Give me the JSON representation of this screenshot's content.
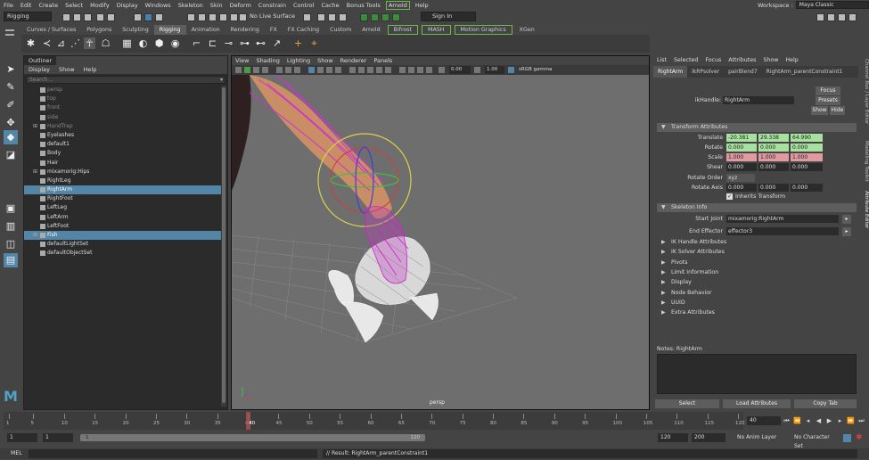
{
  "menubar": {
    "items": [
      "File",
      "Edit",
      "Create",
      "Select",
      "Modify",
      "Display",
      "Windows",
      "Skeleton",
      "Skin",
      "Deform",
      "Constrain",
      "Control",
      "Cache",
      "Bonus Tools",
      "Arnold",
      "Help"
    ],
    "workspace_label": "Workspace :",
    "workspace_value": "Maya Classic"
  },
  "statusline": {
    "menu_set": "Rigging",
    "live_surface": "No Live Surface",
    "sign_in": "Sign In"
  },
  "shelf": {
    "tabs": [
      "Curves / Surfaces",
      "Polygons",
      "Sculpting",
      "Rigging",
      "Animation",
      "Rendering",
      "FX",
      "FX Caching",
      "Custom",
      "Arnold",
      "Bifrost",
      "MASH",
      "Motion Graphics",
      "XGen"
    ],
    "selected_tab": "Rigging"
  },
  "outliner": {
    "title": "Outliner",
    "menu": [
      "Display",
      "Show",
      "Help"
    ],
    "search_placeholder": "Search...",
    "items": [
      {
        "label": "persp",
        "state": "dim"
      },
      {
        "label": "top",
        "state": "dim"
      },
      {
        "label": "front",
        "state": "dim"
      },
      {
        "label": "side",
        "state": "dim"
      },
      {
        "label": "HandTrap",
        "state": "dim"
      },
      {
        "label": "Eyelashes",
        "state": "normal"
      },
      {
        "label": "default1",
        "state": "normal"
      },
      {
        "label": "Body",
        "state": "normal"
      },
      {
        "label": "Hair",
        "state": "normal"
      },
      {
        "label": "mixamorig:Hips",
        "state": "normal"
      },
      {
        "label": "RightLeg",
        "state": "normal"
      },
      {
        "label": "RightArm",
        "state": "selected"
      },
      {
        "label": "RightFoot",
        "state": "normal"
      },
      {
        "label": "LeftLeg",
        "state": "normal"
      },
      {
        "label": "LeftArm",
        "state": "normal"
      },
      {
        "label": "LeftFoot",
        "state": "normal"
      },
      {
        "label": "Fish",
        "state": "selected"
      },
      {
        "label": "defaultLightSet",
        "state": "normal"
      },
      {
        "label": "defaultObjectSet",
        "state": "normal"
      }
    ]
  },
  "viewport": {
    "menu": [
      "View",
      "Shading",
      "Lighting",
      "Show",
      "Renderer",
      "Panels"
    ],
    "near_value": "0.00",
    "far_value": "1.00",
    "color_space": "sRGB gamma",
    "camera_label": "persp"
  },
  "attribute_editor": {
    "menu": [
      "List",
      "Selected",
      "Focus",
      "Attributes",
      "Show",
      "Help"
    ],
    "tabs": [
      "RightArm",
      "ikRPsolver",
      "pairBlend7",
      "RightArm_parentConstraint1"
    ],
    "node_type_label": "ikHandle:",
    "node_name": "RightArm",
    "buttons": {
      "focus": "Focus",
      "presets": "Presets",
      "show": "Show",
      "hide": "Hide"
    },
    "transform_section": "Transform Attributes",
    "translate_label": "Translate",
    "translate": [
      "-20.381",
      "29.338",
      "64.990"
    ],
    "rotate_label": "Rotate",
    "rotate": [
      "0.000",
      "0.000",
      "0.000"
    ],
    "scale_label": "Scale",
    "scale": [
      "1.000",
      "1.000",
      "1.000"
    ],
    "shear_label": "Shear",
    "shear": [
      "0.000",
      "0.000",
      "0.000"
    ],
    "rotate_order_label": "Rotate Order",
    "rotate_order": "xyz",
    "rotate_axis_label": "Rotate Axis",
    "rotate_axis": [
      "0.000",
      "0.000",
      "0.000"
    ],
    "inherits_transform": "Inherits Transform",
    "skeleton_section": "Skeleton Info",
    "start_joint_label": "Start Joint",
    "start_joint": "mixamorig:RightArm",
    "end_effector_label": "End Effector",
    "end_effector": "effector3",
    "collapsed_sections": [
      "IK Handle Attributes",
      "IK Solver Attributes",
      "Pivots",
      "Limit Information",
      "Display",
      "Node Behavior",
      "UUID",
      "Extra Attributes"
    ],
    "notes_label": "Notes:  RightArm",
    "bottom_buttons": [
      "Select",
      "Load Attributes",
      "Copy Tab"
    ]
  },
  "side_tabs": [
    "Channel Box / Layer Editor",
    "Modelling Toolkit",
    "Attribute Editor"
  ],
  "timeslider": {
    "ticks": [
      "1",
      "5",
      "10",
      "15",
      "20",
      "25",
      "30",
      "35",
      "40",
      "45",
      "50",
      "55",
      "60",
      "65",
      "70",
      "75",
      "80",
      "85",
      "90",
      "95",
      "100",
      "105",
      "110",
      "115",
      "120"
    ],
    "current_frame": "40",
    "current_frame_field": "40"
  },
  "range": {
    "start": "1",
    "start2": "1",
    "bar_start": "1",
    "bar_end": "120",
    "end": "120",
    "end2": "200",
    "anim_layer": "No Anim Layer",
    "char_set": "No Character Set"
  },
  "cmdline": {
    "lang": "MEL",
    "result": "// Result: RightArm_parentConstraint1"
  }
}
